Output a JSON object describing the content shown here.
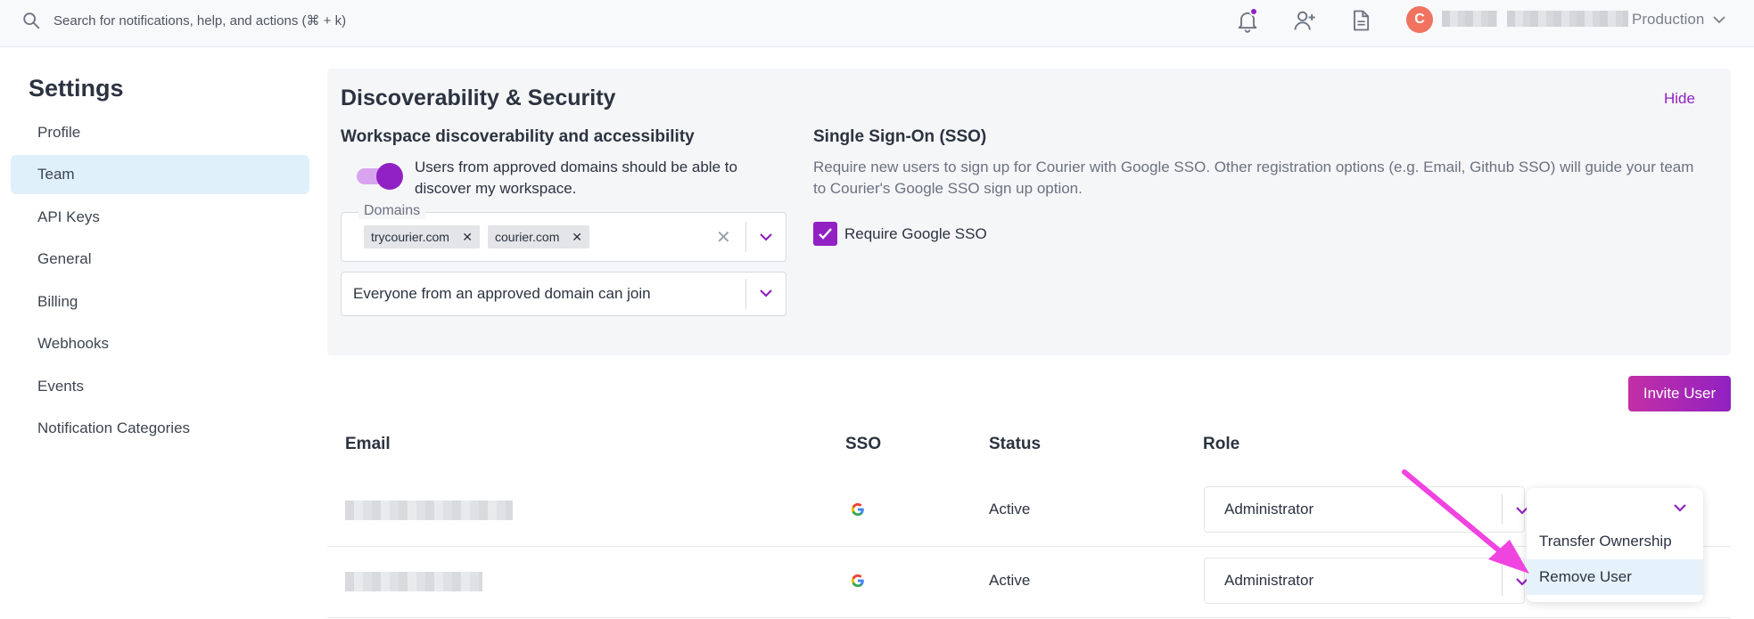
{
  "topbar": {
    "search_placeholder": "Search for notifications, help, and actions (⌘ + k)",
    "avatar_initial": "C",
    "workspace": "Production",
    "accent_color": "#9121c2"
  },
  "sidebar": {
    "title": "Settings",
    "items": [
      {
        "label": "Profile"
      },
      {
        "label": "Team",
        "active": true
      },
      {
        "label": "API Keys"
      },
      {
        "label": "General"
      },
      {
        "label": "Billing"
      },
      {
        "label": "Webhooks"
      },
      {
        "label": "Events"
      },
      {
        "label": "Notification Categories"
      }
    ]
  },
  "discoverability": {
    "title": "Discoverability & Security",
    "hide_label": "Hide",
    "workspace_section": {
      "title": "Workspace discoverability and accessibility",
      "toggle_label": "Users from approved domains should be able to discover my workspace.",
      "toggle_on": true,
      "domains_label": "Domains",
      "domains": [
        "trycourier.com",
        "courier.com"
      ],
      "join_policy": "Everyone from an approved domain can join"
    },
    "sso_section": {
      "title": "Single Sign-On (SSO)",
      "description": "Require new users to sign up for Courier with Google SSO. Other registration options (e.g. Email, Github SSO) will guide your team to Courier's Google SSO sign up option.",
      "checkbox_label": "Require Google SSO",
      "checked": true
    }
  },
  "team": {
    "invite_label": "Invite User",
    "columns": {
      "email": "Email",
      "sso": "SSO",
      "status": "Status",
      "role": "Role"
    },
    "rows": [
      {
        "status": "Active",
        "role": "Administrator"
      },
      {
        "status": "Active",
        "role": "Administrator"
      }
    ],
    "menu": [
      "Transfer Ownership",
      "Remove User"
    ]
  }
}
